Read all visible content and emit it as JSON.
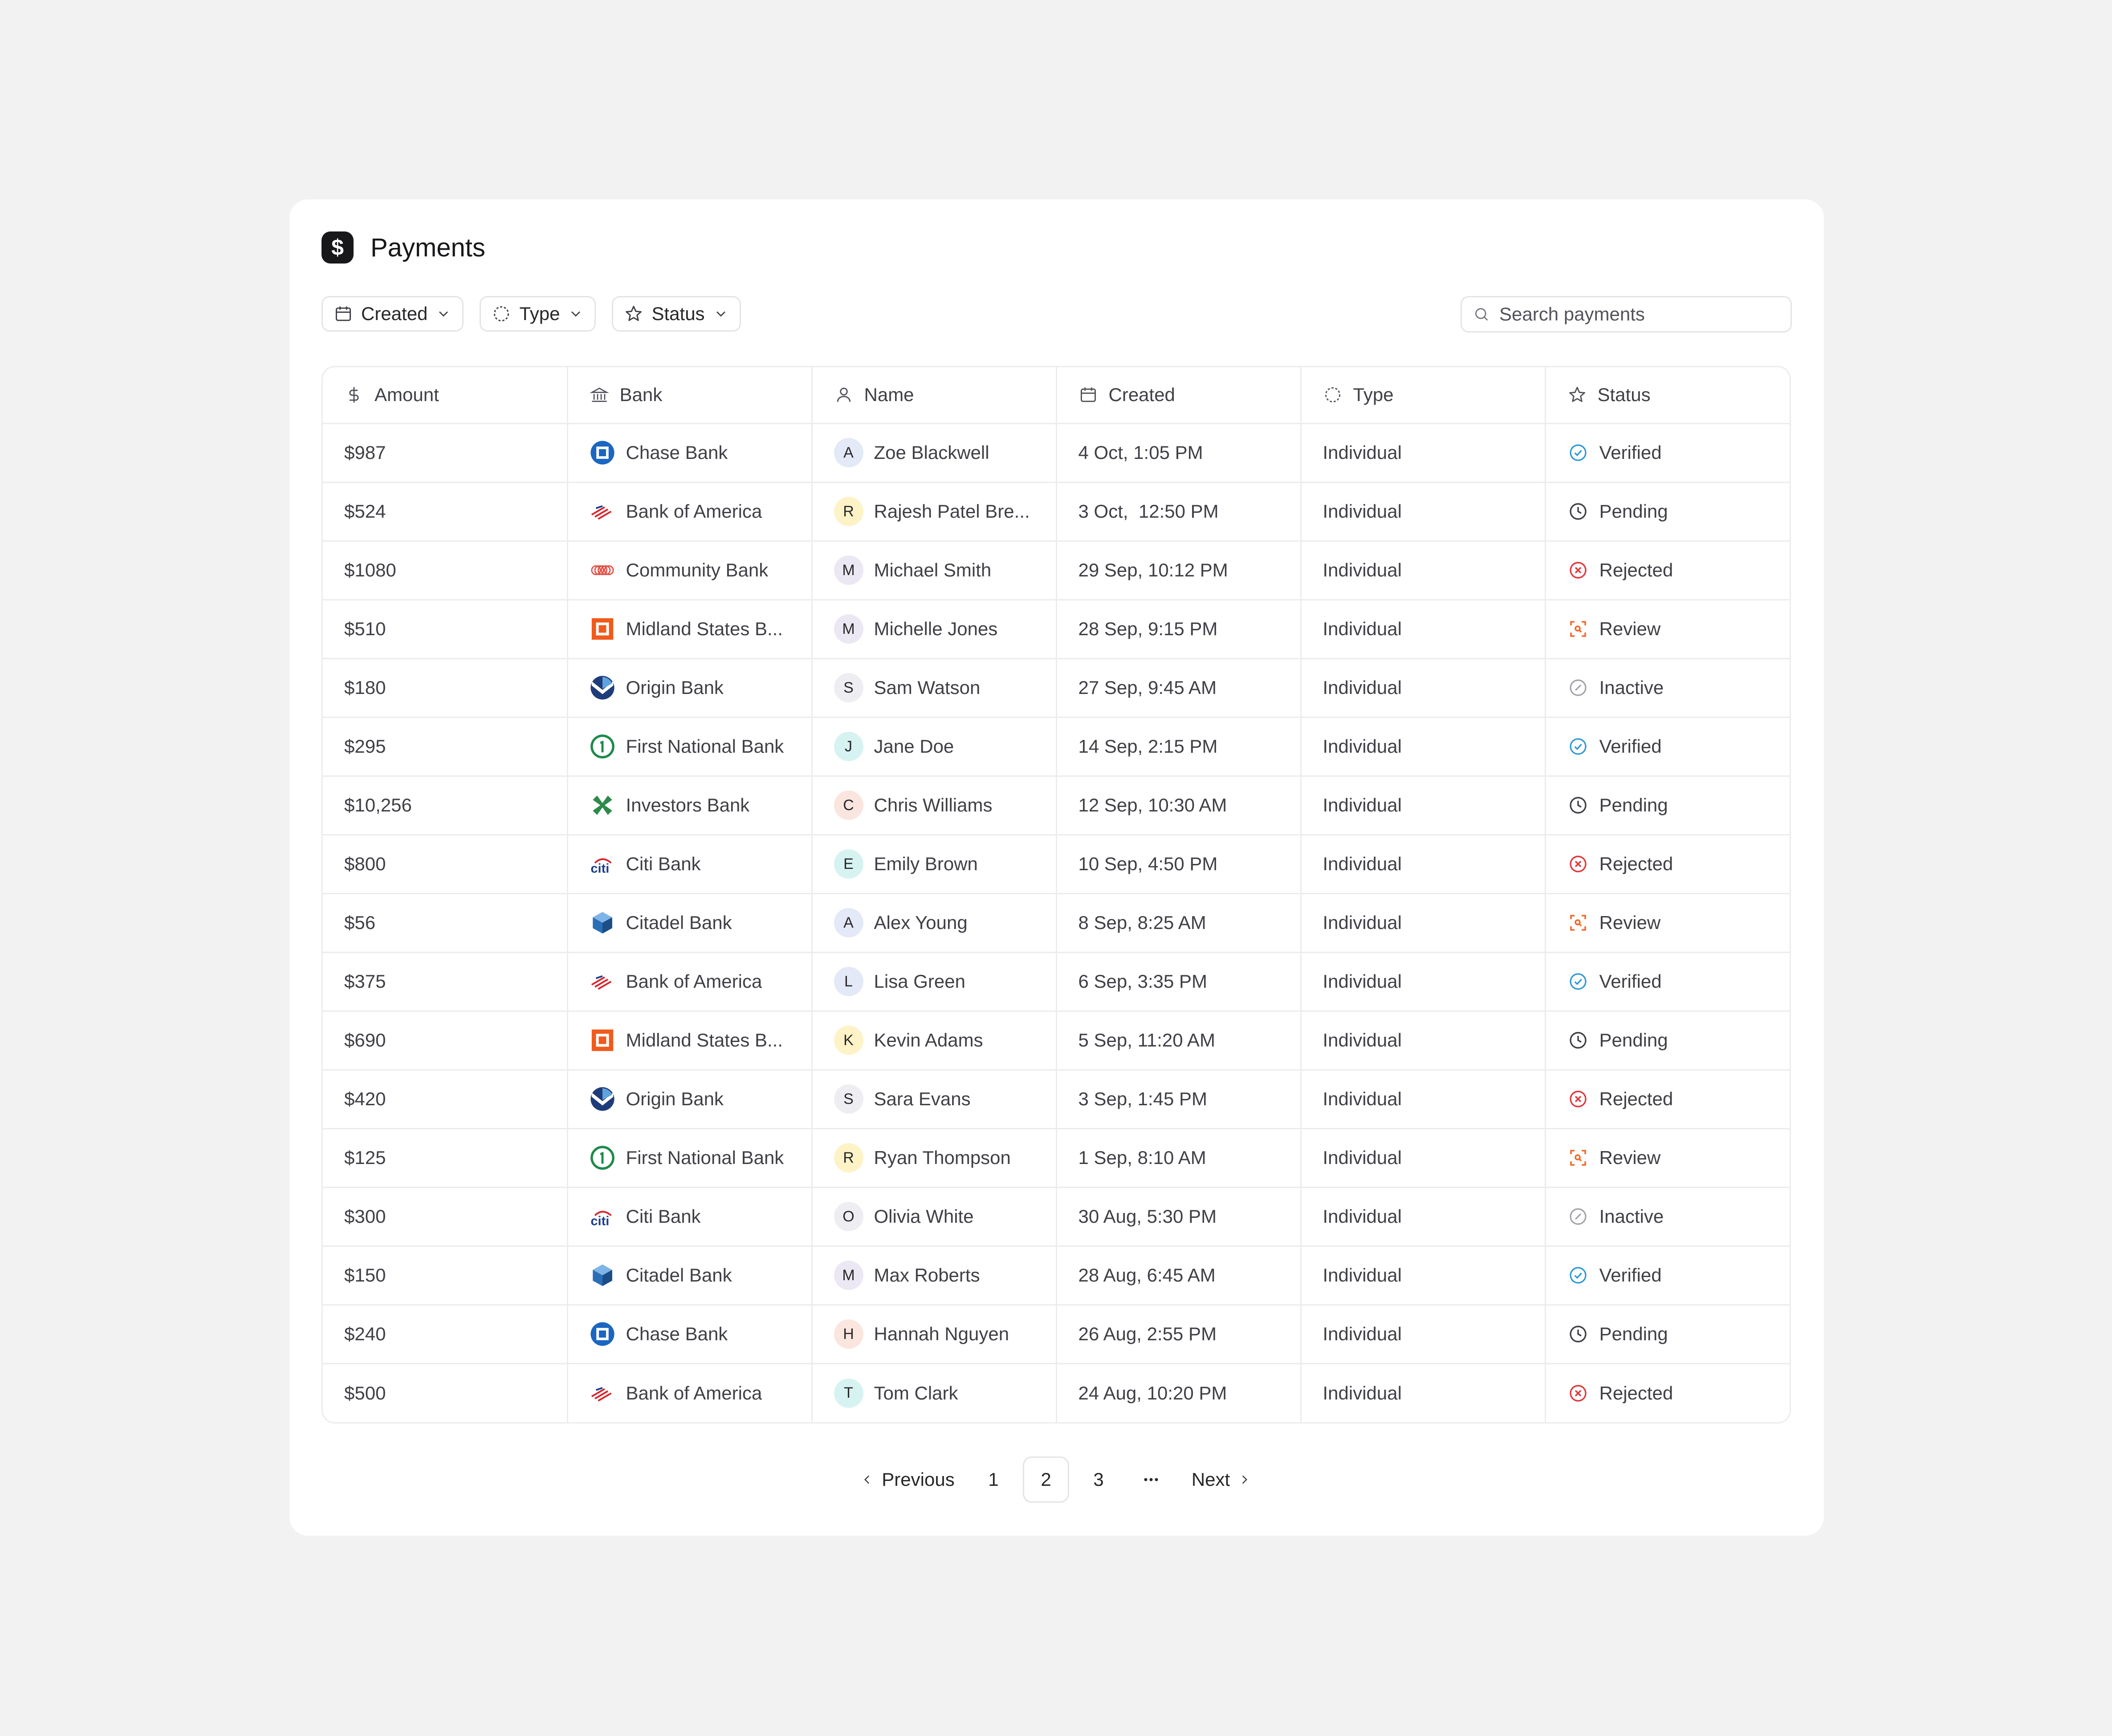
{
  "title": "Payments",
  "title_icon": "dollar-icon",
  "filters": {
    "created": "Created",
    "type": "Type",
    "status": "Status"
  },
  "search": {
    "placeholder": "Search payments"
  },
  "columns": [
    "Amount",
    "Bank",
    "Name",
    "Created",
    "Type",
    "Status"
  ],
  "rows": [
    {
      "amount": "$987",
      "bank": "Chase Bank",
      "bank_logo": "chase",
      "initial": "A",
      "name": "Zoe Blackwell",
      "created": "4 Oct, 1:05 PM",
      "type": "Individual",
      "status": "Verified"
    },
    {
      "amount": "$524",
      "bank": "Bank of America",
      "bank_logo": "boa",
      "initial": "R",
      "name": "Rajesh Patel Bre...",
      "created": "3 Oct,  12:50 PM",
      "type": "Individual",
      "status": "Pending"
    },
    {
      "amount": "$1080",
      "bank": "Community Bank",
      "bank_logo": "community",
      "initial": "M",
      "name": "Michael Smith",
      "created": "29 Sep, 10:12 PM",
      "type": "Individual",
      "status": "Rejected"
    },
    {
      "amount": "$510",
      "bank": "Midland States B...",
      "bank_logo": "midland",
      "initial": "M",
      "name": "Michelle Jones",
      "created": "28 Sep, 9:15 PM",
      "type": "Individual",
      "status": "Review"
    },
    {
      "amount": "$180",
      "bank": "Origin Bank",
      "bank_logo": "origin",
      "initial": "S",
      "name": "Sam Watson",
      "created": "27 Sep, 9:45 AM",
      "type": "Individual",
      "status": "Inactive"
    },
    {
      "amount": "$295",
      "bank": "First National Bank",
      "bank_logo": "firstnational",
      "initial": "J",
      "name": "Jane Doe",
      "created": "14 Sep, 2:15 PM",
      "type": "Individual",
      "status": "Verified"
    },
    {
      "amount": "$10,256",
      "bank": "Investors Bank",
      "bank_logo": "investors",
      "initial": "C",
      "name": "Chris Williams",
      "created": "12 Sep, 10:30 AM",
      "type": "Individual",
      "status": "Pending"
    },
    {
      "amount": "$800",
      "bank": "Citi Bank",
      "bank_logo": "citi",
      "initial": "E",
      "name": "Emily Brown",
      "created": "10 Sep, 4:50 PM",
      "type": "Individual",
      "status": "Rejected"
    },
    {
      "amount": "$56",
      "bank": "Citadel Bank",
      "bank_logo": "citadel",
      "initial": "A",
      "name": "Alex Young",
      "created": "8 Sep, 8:25 AM",
      "type": "Individual",
      "status": "Review"
    },
    {
      "amount": "$375",
      "bank": "Bank of America",
      "bank_logo": "boa",
      "initial": "L",
      "name": "Lisa Green",
      "created": "6 Sep, 3:35 PM",
      "type": "Individual",
      "status": "Verified"
    },
    {
      "amount": "$690",
      "bank": "Midland States B...",
      "bank_logo": "midland",
      "initial": "K",
      "name": "Kevin Adams",
      "created": "5 Sep, 11:20 AM",
      "type": "Individual",
      "status": "Pending"
    },
    {
      "amount": "$420",
      "bank": "Origin Bank",
      "bank_logo": "origin",
      "initial": "S",
      "name": "Sara Evans",
      "created": "3 Sep, 1:45 PM",
      "type": "Individual",
      "status": "Rejected"
    },
    {
      "amount": "$125",
      "bank": "First National Bank",
      "bank_logo": "firstnational",
      "initial": "R",
      "name": "Ryan Thompson",
      "created": "1 Sep, 8:10 AM",
      "type": "Individual",
      "status": "Review"
    },
    {
      "amount": "$300",
      "bank": "Citi Bank",
      "bank_logo": "citi",
      "initial": "O",
      "name": "Olivia White",
      "created": "30 Aug, 5:30 PM",
      "type": "Individual",
      "status": "Inactive"
    },
    {
      "amount": "$150",
      "bank": "Citadel Bank",
      "bank_logo": "citadel",
      "initial": "M",
      "name": "Max Roberts",
      "created": "28 Aug, 6:45 AM",
      "type": "Individual",
      "status": "Verified"
    },
    {
      "amount": "$240",
      "bank": "Chase Bank",
      "bank_logo": "chase",
      "initial": "H",
      "name": "Hannah Nguyen",
      "created": "26 Aug, 2:55 PM",
      "type": "Individual",
      "status": "Pending"
    },
    {
      "amount": "$500",
      "bank": "Bank of America",
      "bank_logo": "boa",
      "initial": "T",
      "name": "Tom Clark",
      "created": "24 Aug, 10:20 PM",
      "type": "Individual",
      "status": "Rejected"
    }
  ],
  "avatar_colors": {
    "A": "#e3e9f6",
    "R": "#fdf3c7",
    "M": "#ece8f3",
    "S": "#eeeef2",
    "J": "#d6f3f2",
    "C": "#fbe5df",
    "E": "#d6f3f2",
    "L": "#e3e9f6",
    "K": "#fdf3c7",
    "O": "#eeeef2",
    "H": "#fbe5df",
    "T": "#d6f3f2"
  },
  "status_colors": {
    "Verified": "#2a96d8",
    "Pending": "#3f3f46",
    "Rejected": "#e0393e",
    "Review": "#f2692b",
    "Inactive": "#a1a1aa"
  },
  "pagination": {
    "previous": "Previous",
    "pages": [
      "1",
      "2",
      "3"
    ],
    "current": "2",
    "more": "...",
    "next": "Next"
  }
}
